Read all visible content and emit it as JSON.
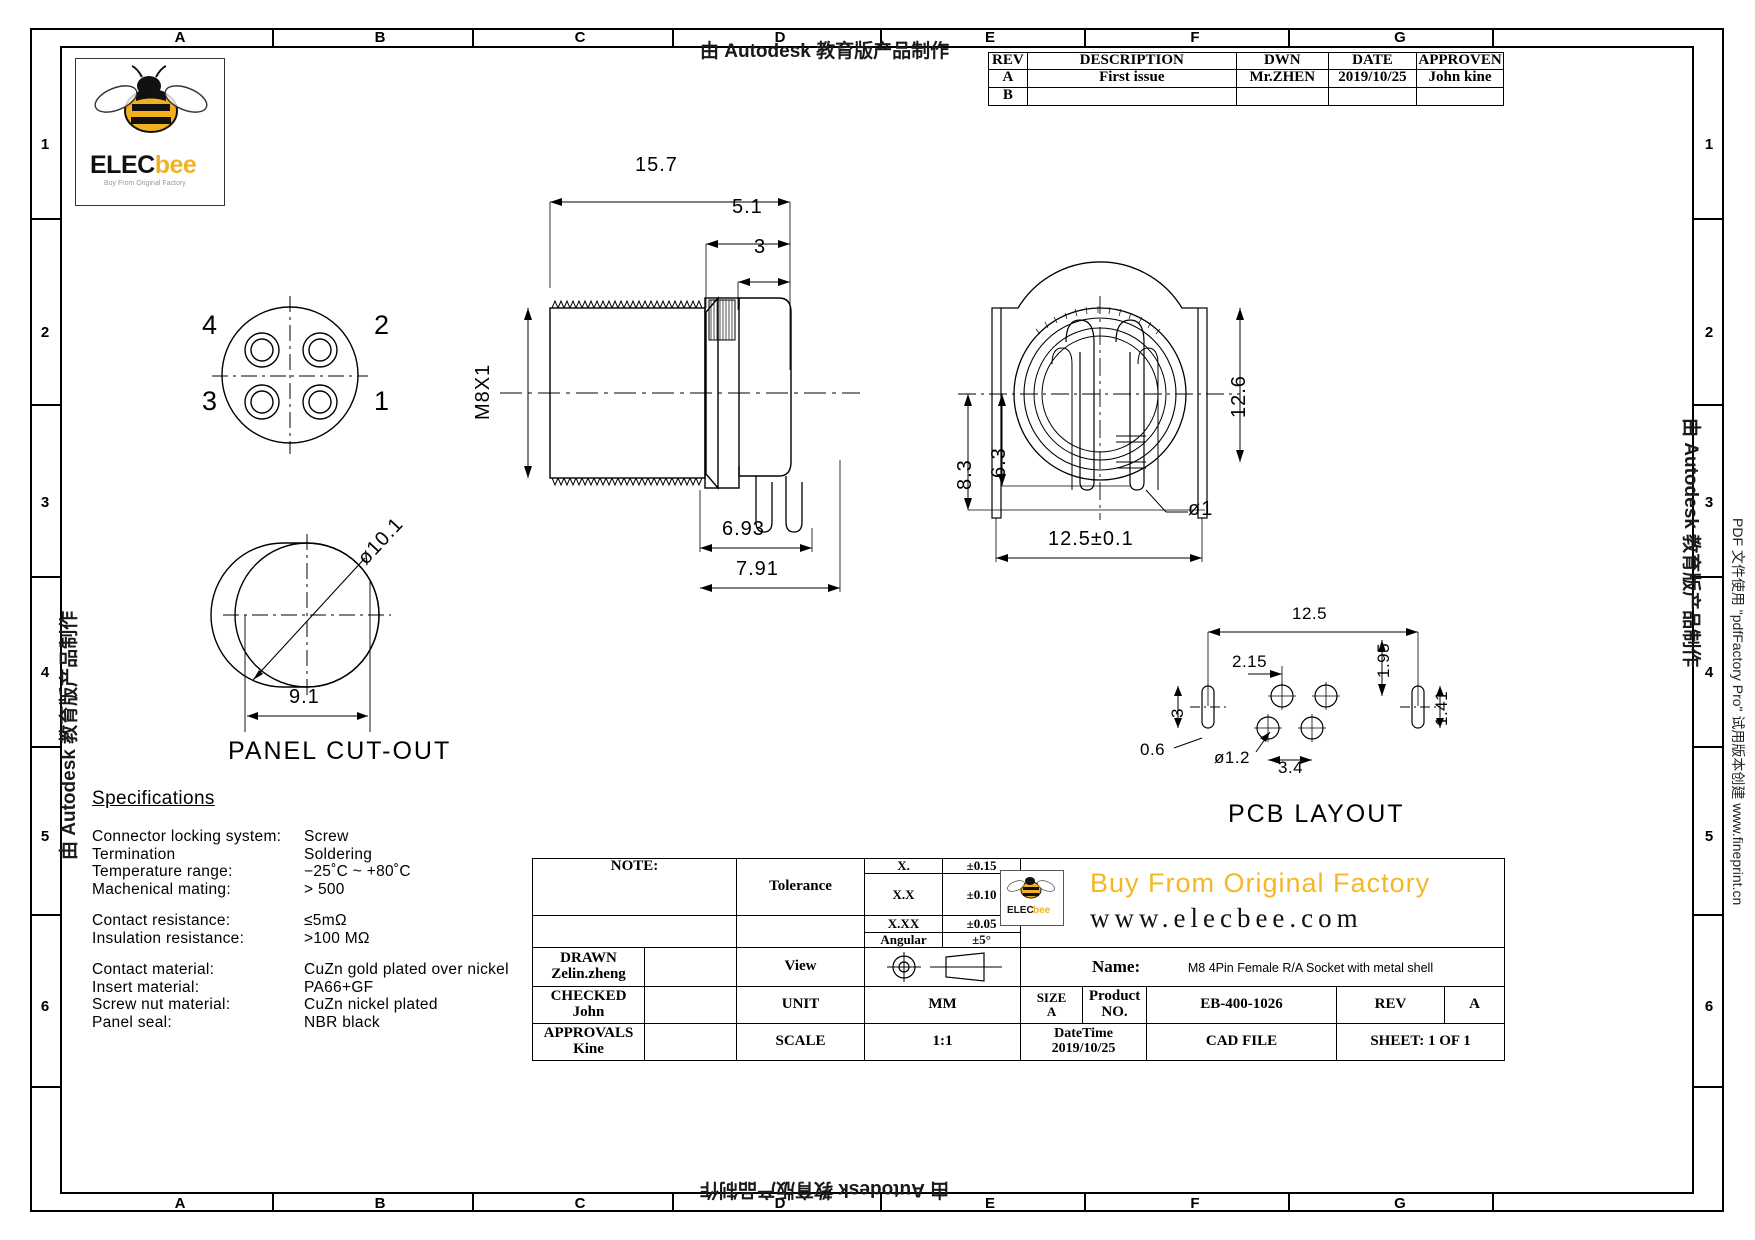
{
  "frame": {
    "zone_cols_top": [
      "A",
      "B",
      "C",
      "D",
      "E",
      "F",
      "G"
    ],
    "zone_cols_bottom": [
      "A",
      "B",
      "C",
      "D",
      "E",
      "F",
      "G"
    ],
    "zone_rows_left": [
      "1",
      "2",
      "3",
      "4",
      "5",
      "6"
    ],
    "zone_rows_right": [
      "1",
      "2",
      "3",
      "4",
      "5",
      "6"
    ]
  },
  "watermark": {
    "top": "由 Autodesk 教育版产品制作",
    "bottom": "由 Autodesk 教育版产品制作",
    "left": "由 Autodesk 教育版产品制作",
    "right": "由 Autodesk 教育版产品制作",
    "far_right": "PDF 文件使用 \"pdfFactory Pro\" 试用版本创建 www.fineprint.cn"
  },
  "logo": {
    "name_dark": "ELEC",
    "name_yellow": "bee",
    "tagline": "Buy From Original Factory"
  },
  "revision_table": {
    "headers": [
      "REV",
      "DESCRIPTION",
      "DWN",
      "DATE",
      "APPROVEN"
    ],
    "rows": [
      {
        "rev": "A",
        "description": "First issue",
        "dwn": "Mr.ZHEN",
        "date": "2019/10/25",
        "approven": "John kine"
      },
      {
        "rev": "B",
        "description": "",
        "dwn": "",
        "date": "",
        "approven": ""
      }
    ]
  },
  "views": {
    "pin_view": {
      "pins": [
        "4",
        "2",
        "3",
        "1"
      ]
    },
    "panel_cutout": {
      "title": "PANEL CUT-OUT",
      "diameter": "ø10.1",
      "width": "9.1"
    },
    "side_view": {
      "thread": "M8X1",
      "dim_total": "15.7",
      "dim_nut": "5.1",
      "dim_flange": "3",
      "dim_lower1": "6.93",
      "dim_lower2": "7.91"
    },
    "front_view": {
      "dim_height_outer": "8.3",
      "dim_height_inner": "6.3",
      "dim_width": "12.6",
      "pin_dia": "ø1",
      "dim_base": "12.5±0.1"
    },
    "pcb_layout": {
      "title": "PCB LAYOUT",
      "dim_width": "12.5",
      "dim_x1": "2.15",
      "dim_y1": "1.95",
      "dim_y2": "1.41",
      "dim_slot_h": "3",
      "dim_slot_w": "0.6",
      "hole_dia": "ø1.2",
      "dim_x2": "3.4"
    }
  },
  "specifications": {
    "title": "Specifications",
    "group1": [
      {
        "key": "Connector locking system:",
        "value": "Screw"
      },
      {
        "key": "Termination",
        "value": "Soldering"
      },
      {
        "key": "Temperature range:",
        "value": "−25˚C ~ +80˚C"
      },
      {
        "key": "Machenical mating:",
        "value": "> 500"
      }
    ],
    "group2": [
      {
        "key": "Contact resistance:",
        "value": "≤5mΩ"
      },
      {
        "key": "Insulation resistance:",
        "value": ">100 MΩ"
      }
    ],
    "group3": [
      {
        "key": "Contact material:",
        "value": "CuZn gold plated over nickel"
      },
      {
        "key": "Insert material:",
        "value": "PA66+GF"
      },
      {
        "key": "Screw nut material:",
        "value": "CuZn nickel plated"
      },
      {
        "key": "Panel seal:",
        "value": "NBR black"
      }
    ]
  },
  "title_block": {
    "note_label": "NOTE:",
    "drawn_label": "DRAWN",
    "drawn_value": "Zelin.zheng",
    "checked_label": "CHECKED",
    "checked_value": "John",
    "approvals_label": "APPROVALS",
    "approvals_value": "Kine",
    "tolerance_label": "Tolerance",
    "tolerance_rows": [
      {
        "key": "X.",
        "value": "±0.15"
      },
      {
        "key": "X.X",
        "value": "±0.10"
      },
      {
        "key": "X.XX",
        "value": "±0.05"
      },
      {
        "key": "Angular",
        "value": "±5°"
      }
    ],
    "view_label": "View",
    "unit_label": "UNIT",
    "unit_value": "MM",
    "scale_label": "SCALE",
    "scale_value": "1:1",
    "banner_line1": "Buy From Original  Factory",
    "banner_line2": "www.elecbee.com",
    "name_label": "Name:",
    "name_value": "M8 4Pin Female R/A Socket with metal shell",
    "size_label": "SIZE",
    "size_value": "A",
    "product_no_label": "Product NO.",
    "product_no_value": "EB-400-1026",
    "rev_label": "REV",
    "rev_value": "A",
    "datetime_label": "DateTime",
    "datetime_value": "2019/10/25",
    "cad_file_label": "CAD FILE",
    "cad_file_value": "",
    "sheet_label": "SHEET: 1 OF 1"
  },
  "colors": {
    "brand_yellow": "#f0b323",
    "line": "#000000"
  }
}
